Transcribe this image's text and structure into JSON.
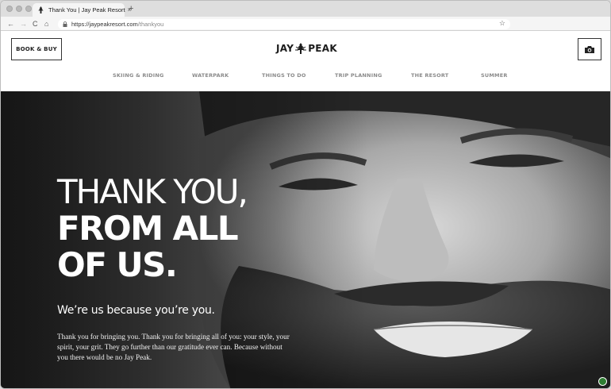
{
  "browser": {
    "tab_title": "Thank You | Jay Peak Resort",
    "tab_close": "×",
    "new_tab": "+",
    "url_host": "https://jaypeakresort.com",
    "url_path": "/thankyou",
    "back": "←",
    "forward": "→",
    "reload": "C",
    "home": "⌂",
    "bookmark": "☆"
  },
  "header": {
    "book_button": "BOOK & BUY",
    "logo_left": "JAY",
    "logo_right": "PEAK",
    "nav": [
      "SKIING & RIDING",
      "WATERPARK",
      "THINGS TO DO",
      "TRIP PLANNING",
      "THE RESORT",
      "SUMMER"
    ]
  },
  "hero": {
    "headline_line1": "THANK YOU,",
    "headline_line2": "FROM ALL",
    "headline_line3": "OF US.",
    "subheading": "We’re us because you’re you.",
    "body": "Thank you for bringing you. Thank you for bringing all of you: your style, your spirit, your grit. They go further than our gratitude ever can. Because without you there would be no Jay Peak."
  },
  "colors": {
    "nav_text": "#8a8a8a",
    "hero_text": "#ffffff",
    "chat_badge": "#2e7d32"
  },
  "icons": [
    "tree-favicon-icon",
    "lock-icon",
    "camera-icon",
    "chat-icon",
    "star-icon"
  ]
}
